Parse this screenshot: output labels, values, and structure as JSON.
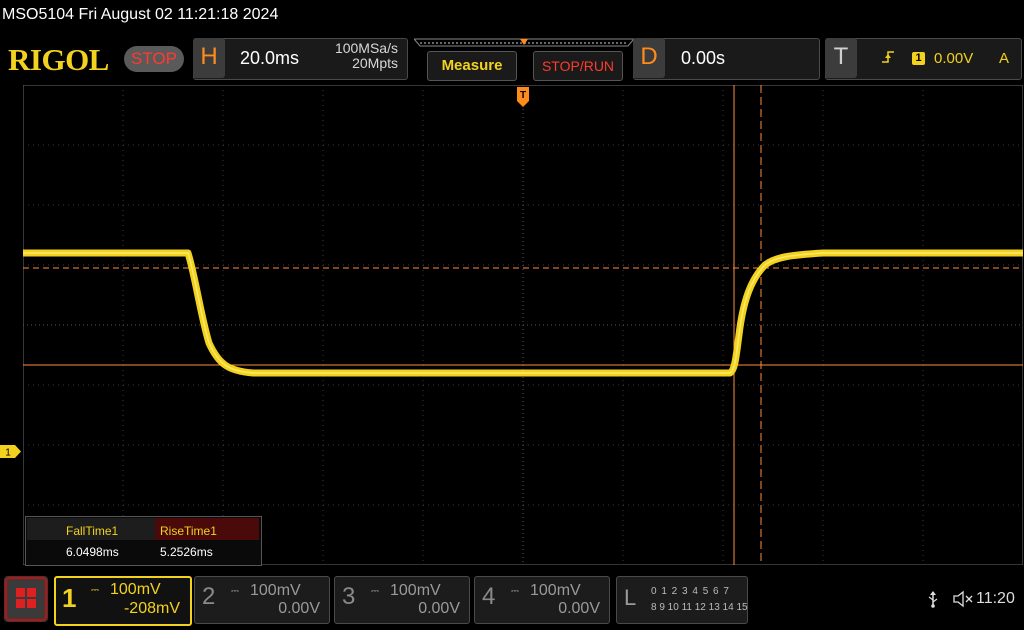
{
  "title_bar": {
    "text": "MSO5104  Fri August 02 11:21:18 2024"
  },
  "toolbar": {
    "logo": "RIGOL",
    "run_state": "STOP",
    "horizontal": {
      "letter": "H",
      "time_base": "20.0ms",
      "sample_rate": "100MSa/s",
      "memory_depth": "20Mpts"
    },
    "measure_label": "Measure",
    "stop_run_label": "STOP/RUN",
    "delay": {
      "letter": "D",
      "value": "0.00s"
    },
    "trigger": {
      "letter": "T",
      "edge_icon": "rising-edge-icon",
      "source": "1",
      "level": "0.00V",
      "mode": "A"
    }
  },
  "waveform": {
    "channel_marker": "1",
    "color": "#f2d21e",
    "cursor_color": "#ff8c3a"
  },
  "measurements": [
    {
      "name": "FallTime1",
      "value": "6.0498ms"
    },
    {
      "name": "RiseTime1",
      "value": "5.2526ms"
    }
  ],
  "channels": [
    {
      "num": "1",
      "scale": "100mV",
      "offset": "-208mV",
      "active": true
    },
    {
      "num": "2",
      "scale": "100mV",
      "offset": "0.00V",
      "active": false
    },
    {
      "num": "3",
      "scale": "100mV",
      "offset": "0.00V",
      "active": false
    },
    {
      "num": "4",
      "scale": "100mV",
      "offset": "0.00V",
      "active": false
    }
  ],
  "logic_analyzer": {
    "letter": "L",
    "row1": "0 1 2 3  4 5 6 7",
    "row2": "8 9 10 11 12 13 14 15"
  },
  "status": {
    "usb_icon": "usb-icon",
    "sound_icon": "speaker-muted-icon",
    "time": "11:20"
  },
  "colors": {
    "accent_yellow": "#f2d21e",
    "accent_orange": "#ff8c1a",
    "stop_red": "#ff3b30"
  }
}
